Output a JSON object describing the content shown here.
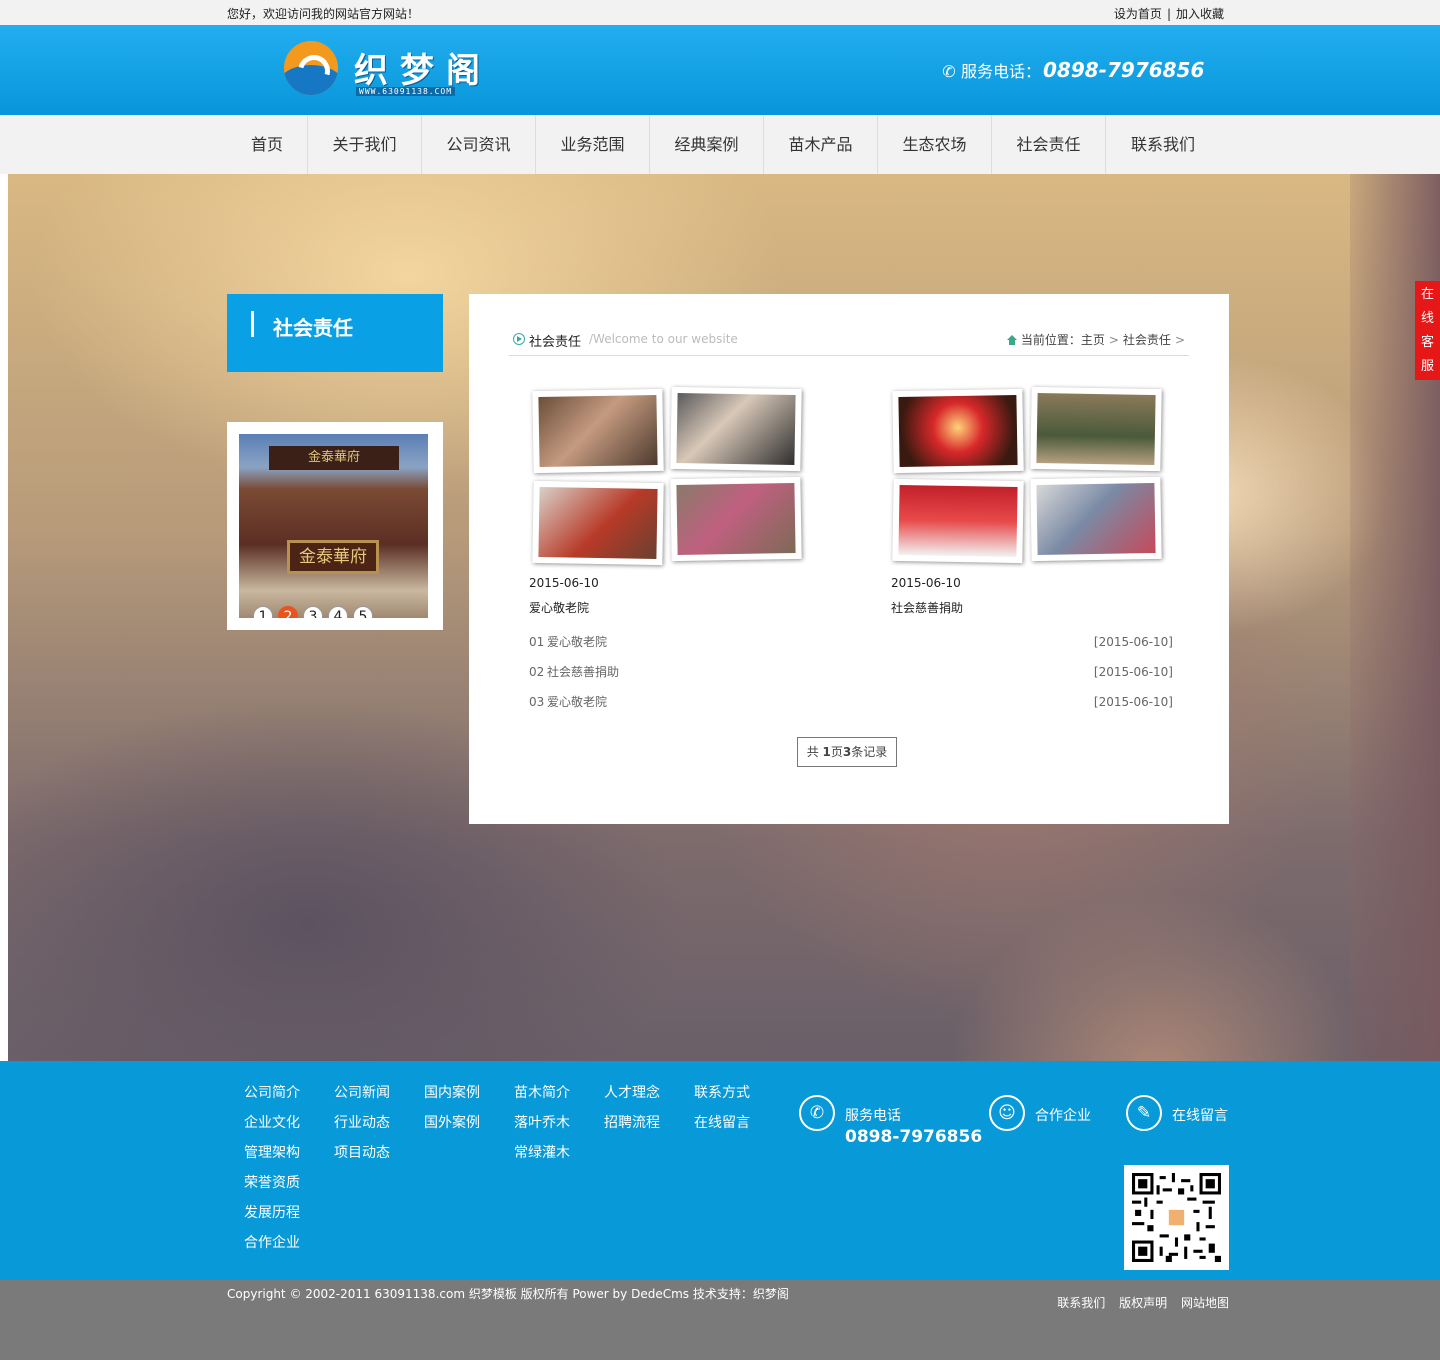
{
  "topbar": {
    "welcome": "您好，欢迎访问我的网站官方网站！",
    "set_home": "设为首页",
    "separator": "|",
    "add_fav": "加入收藏"
  },
  "header": {
    "logo_text": "织梦阁",
    "logo_sub": "WWW.63091138.COM",
    "hotline_label": "服务电话：",
    "hotline_number": "0898-7976856"
  },
  "nav": {
    "items": [
      "首页",
      "关于我们",
      "公司资讯",
      "业务范围",
      "经典案例",
      "苗木产品",
      "生态农场",
      "社会责任",
      "联系我们"
    ]
  },
  "sidebar": {
    "title": "社会责任",
    "slide": {
      "roof_text": "金泰華府",
      "sign_text": "金泰華府",
      "dots": [
        "1",
        "2",
        "3",
        "4",
        "5"
      ],
      "active_dot": 2
    }
  },
  "content": {
    "title": "社会责任",
    "subtitle": "/Welcome to our website",
    "location_label": "当前位置：",
    "crumbs": [
      "主页",
      "社会责任"
    ],
    "arrow": ">",
    "cards": [
      {
        "date": "2015-06-10",
        "name": "爱心敬老院"
      },
      {
        "date": "2015-06-10",
        "name": "社会慈善捐助"
      }
    ],
    "list": [
      {
        "idx": "01",
        "title": "爱心敬老院",
        "date": "[2015-06-10]"
      },
      {
        "idx": "02",
        "title": "社会慈善捐助",
        "date": "[2015-06-10]"
      },
      {
        "idx": "03",
        "title": "爱心敬老院",
        "date": "[2015-06-10]"
      }
    ],
    "pager": {
      "prefix": "共 ",
      "pages": "1",
      "mid": "页",
      "count": "3",
      "suffix": "条记录"
    }
  },
  "online_service": [
    "在",
    "线",
    "客",
    "服"
  ],
  "footer": {
    "columns": [
      [
        "公司简介",
        "企业文化",
        "管理架构",
        "荣誉资质",
        "发展历程",
        "合作企业"
      ],
      [
        "公司新闻",
        "行业动态",
        "项目动态"
      ],
      [
        "国内案例",
        "国外案例"
      ],
      [
        "苗木简介",
        "落叶乔木",
        "常绿灌木"
      ],
      [
        "人才理念",
        "招聘流程"
      ],
      [
        "联系方式",
        "在线留言"
      ]
    ],
    "phone_label": "服务电话",
    "phone_number": "0898-7976856",
    "partners_label": "合作企业",
    "message_label": "在线留言"
  },
  "copyright": {
    "text": "Copyright © 2002-2011 63091138.com 织梦模板 版权所有 Power by DedeCms 技术支持：织梦阁",
    "links": [
      "联系我们",
      "版权声明",
      "网站地图"
    ]
  },
  "colors": {
    "brand_blue": "#0aa0e6",
    "footer_blue": "#0899d8",
    "online_red": "#e51717",
    "active_dot": "#e8531f"
  }
}
